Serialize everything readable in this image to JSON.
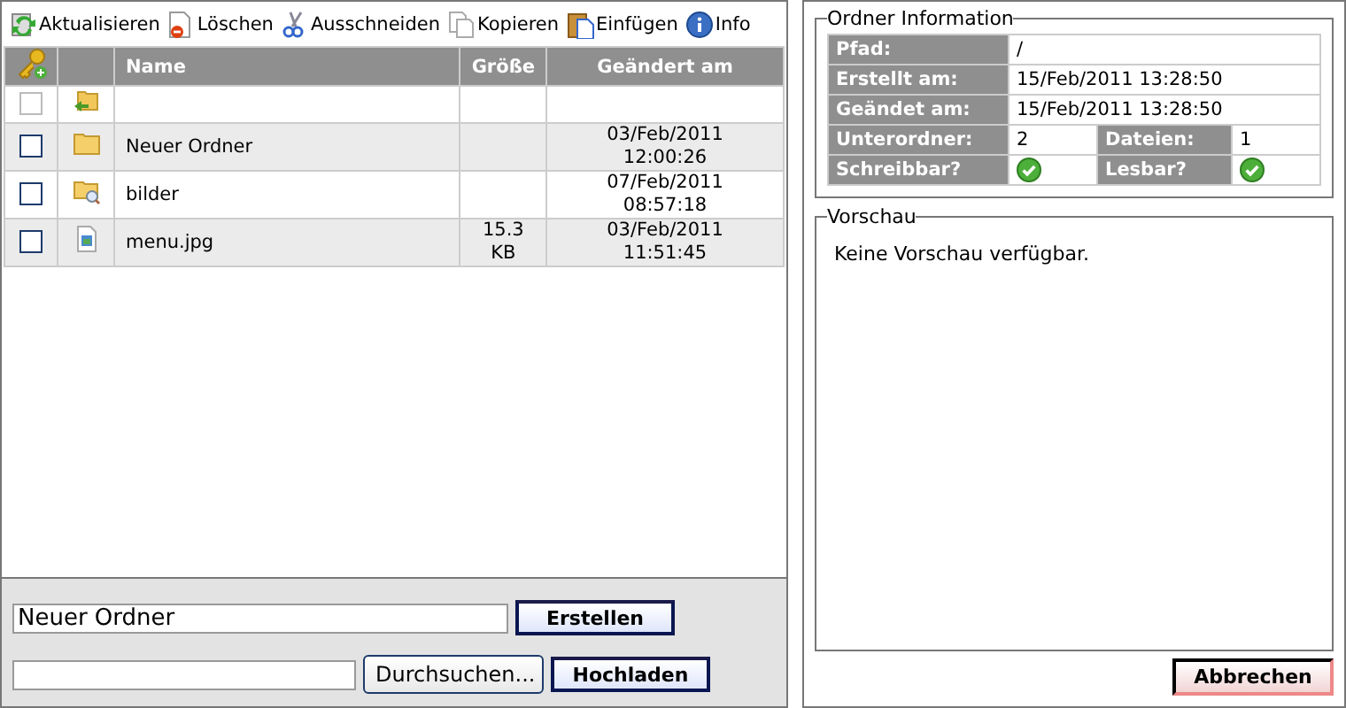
{
  "toolbar": [
    {
      "label": "Aktualisieren",
      "kind": "refresh"
    },
    {
      "label": "Löschen",
      "kind": "delete"
    },
    {
      "label": "Ausschneiden",
      "kind": "cut"
    },
    {
      "label": "Kopieren",
      "kind": "copy"
    },
    {
      "label": "Einfügen",
      "kind": "paste"
    },
    {
      "label": "Info",
      "kind": "info"
    }
  ],
  "table": {
    "columns": [
      "Name",
      "Größe",
      "Geändert am"
    ],
    "rows": [
      {
        "kind": "parent",
        "checked": false,
        "disabled": true
      },
      {
        "kind": "folder",
        "name": "Neuer Ordner",
        "checked": false,
        "disabled": false,
        "modified": [
          "03/Feb/2011",
          "12:00:26"
        ]
      },
      {
        "kind": "folder-search",
        "name": "bilder",
        "checked": false,
        "disabled": false,
        "modified": [
          "07/Feb/2011",
          "08:57:18"
        ]
      },
      {
        "kind": "image",
        "name": "menu.jpg",
        "checked": false,
        "disabled": false,
        "size": [
          "15.3",
          "KB"
        ],
        "modified": [
          "03/Feb/2011",
          "11:51:45"
        ]
      }
    ]
  },
  "create": {
    "value": "Neuer Ordner",
    "button": "Erstellen"
  },
  "upload": {
    "browse": "Durchsuchen...",
    "button": "Hochladen"
  },
  "info": {
    "title": "Ordner Information",
    "rows": [
      [
        {
          "label": "Pfad:",
          "value": "/"
        }
      ],
      [
        {
          "label": "Erstellt am:",
          "value": "15/Feb/2011 13:28:50"
        }
      ],
      [
        {
          "label": "Geändet am:",
          "value": "15/Feb/2011 13:28:50"
        }
      ],
      [
        {
          "label": "Unterordner:",
          "value": "2"
        },
        {
          "label": "Dateien:",
          "value": "1"
        }
      ],
      [
        {
          "label": "Schreibbar?",
          "ok": true
        },
        {
          "label": "Lesbar?",
          "ok": true
        }
      ]
    ]
  },
  "preview": {
    "title": "Vorschau",
    "text": "Keine Vorschau verfügbar."
  },
  "cancel": "Abbrechen"
}
